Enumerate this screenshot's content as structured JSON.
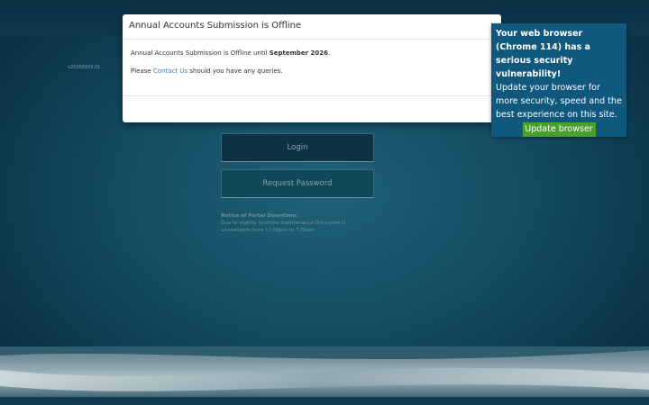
{
  "version": "v20250926.01",
  "modal": {
    "title": "Annual Accounts Submission is Offline",
    "offline_prefix": "Annual Accounts Submission is Offline until ",
    "offline_date": "September 2026",
    "offline_suffix": ".",
    "please": "Please ",
    "contact_link": "Contact Us",
    "queries": " should you have any queries."
  },
  "update": {
    "warning": "Your web browser (Chrome 114) has a serious security vulnerability!",
    "message": "Update your browser for more security, speed and the best experience on this site.",
    "button": "Update browser"
  },
  "buttons": {
    "login": "Login",
    "request_password": "Request Password"
  },
  "notice": {
    "heading": "Notice of Portal Downtime:",
    "body": "Due to nightly systems maintenance the portal is unavailable from 11.00pm to 7.00am"
  },
  "colors": {
    "background": "#134b62",
    "update_box": "#10587d",
    "update_button": "#4a9f2e",
    "link": "#3a7fc1"
  }
}
